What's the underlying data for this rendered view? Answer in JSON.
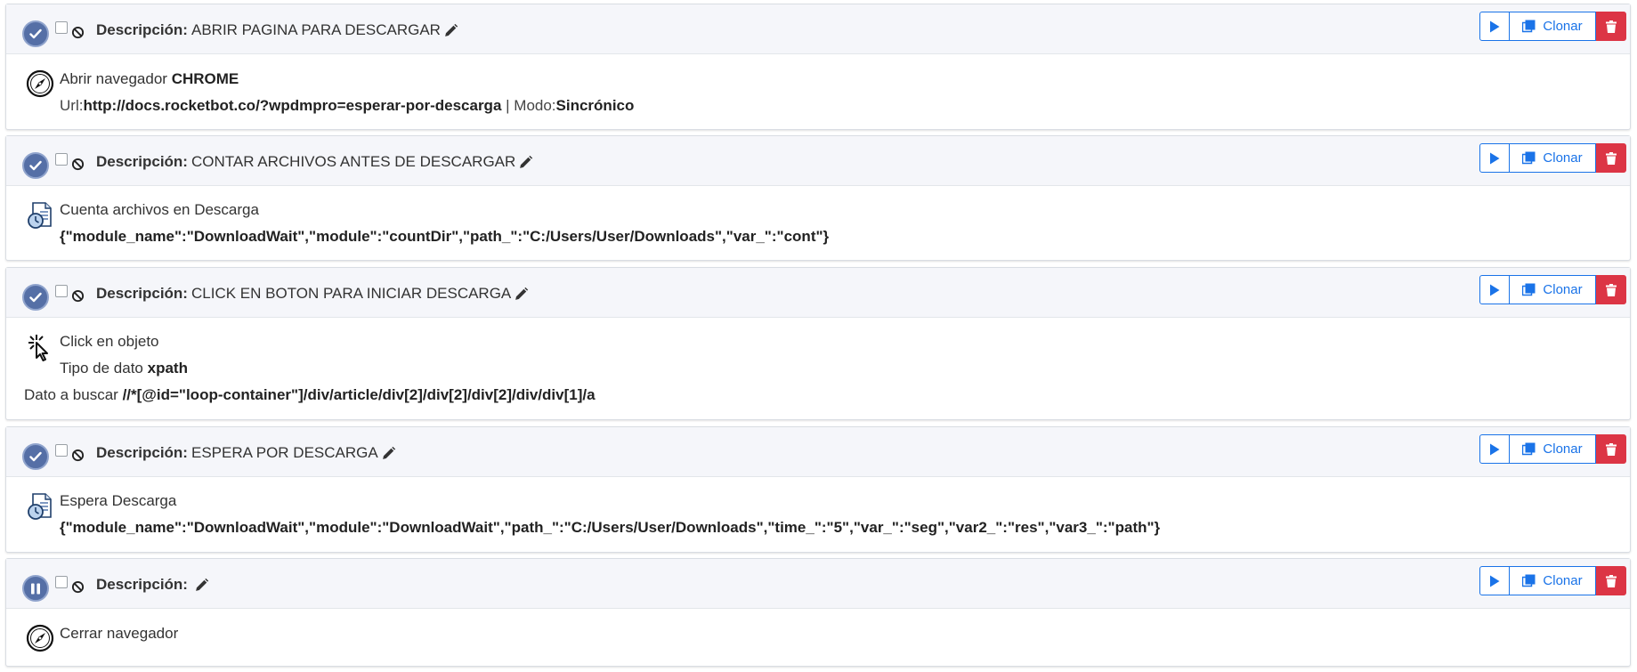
{
  "desc_label": "Descripción:",
  "buttons": {
    "clone_label": "Clonar"
  },
  "commands": [
    {
      "description": "ABRIR PAGINA PARA DESCARGAR",
      "status": "enabled",
      "title_plain": "Abrir navegador ",
      "title_bold": "CHROME",
      "line2": {
        "url_label": "Url:",
        "url_value": "http://docs.rocketbot.co/?wpdmpro=esperar-por-descarga",
        "sep": " | ",
        "mode_label": "Modo:",
        "mode_value": "Sincrónico"
      },
      "icon": "compass-icon"
    },
    {
      "description": "CONTAR ARCHIVOS ANTES DE DESCARGAR",
      "status": "enabled",
      "title_plain": "Cuenta archivos en Descarga",
      "line2_bold": "{\"module_name\":\"DownloadWait\",\"module\":\"countDir\",\"path_\":\"C:/Users/User/Downloads\",\"var_\":\"cont\"}",
      "icon": "file-clock-icon"
    },
    {
      "description": "CLICK EN BOTON PARA INICIAR DESCARGA",
      "status": "enabled",
      "title_plain": "Click en objeto",
      "line2": {
        "label": "Tipo de dato ",
        "value": "xpath"
      },
      "line3": {
        "label": "Dato a buscar ",
        "value": "//*[@id=\"loop-container\"]/div/article/div[2]/div[2]/div[2]/div/div[1]/a"
      },
      "icon": "click-cursor-icon"
    },
    {
      "description": "ESPERA POR DESCARGA",
      "status": "enabled",
      "title_plain": "Espera Descarga",
      "line2_bold": "{\"module_name\":\"DownloadWait\",\"module\":\"DownloadWait\",\"path_\":\"C:/Users/User/Downloads\",\"time_\":\"5\",\"var_\":\"seg\",\"var2_\":\"res\",\"var3_\":\"path\"}",
      "icon": "file-clock-icon"
    },
    {
      "description": "",
      "status": "paused",
      "title_plain": "Cerrar navegador",
      "icon": "compass-icon"
    }
  ],
  "colors": {
    "accent": "#1a73e8",
    "danger": "#dc3545",
    "badge": "#556fa6",
    "header_bg": "#f5f6fa"
  }
}
